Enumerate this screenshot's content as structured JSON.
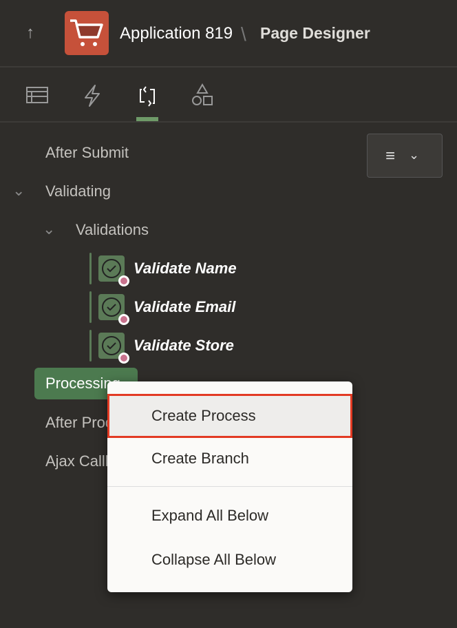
{
  "header": {
    "back_icon": "arrow-up-icon",
    "app_title": "Application 819",
    "separator": "\\",
    "page_title": "Page Designer"
  },
  "tabs": [
    {
      "name": "rendering",
      "icon": "layout-icon"
    },
    {
      "name": "dynamic-actions",
      "icon": "lightning-icon"
    },
    {
      "name": "processing",
      "icon": "refresh-icon",
      "active": true
    },
    {
      "name": "shared-components",
      "icon": "shapes-icon"
    }
  ],
  "tree": {
    "after_submit": "After Submit",
    "validating": "Validating",
    "validations": "Validations",
    "items": [
      "Validate Name",
      "Validate Email",
      "Validate Store"
    ],
    "processing": "Processing",
    "after_processing": "After Processing",
    "ajax": "Ajax Callback"
  },
  "context_menu": {
    "items": [
      "Create Process",
      "Create Branch",
      "Expand All Below",
      "Collapse All Below"
    ]
  },
  "colors": {
    "accent": "#6e9a68",
    "highlight": "#e23a23",
    "logo": "#c6513a"
  }
}
